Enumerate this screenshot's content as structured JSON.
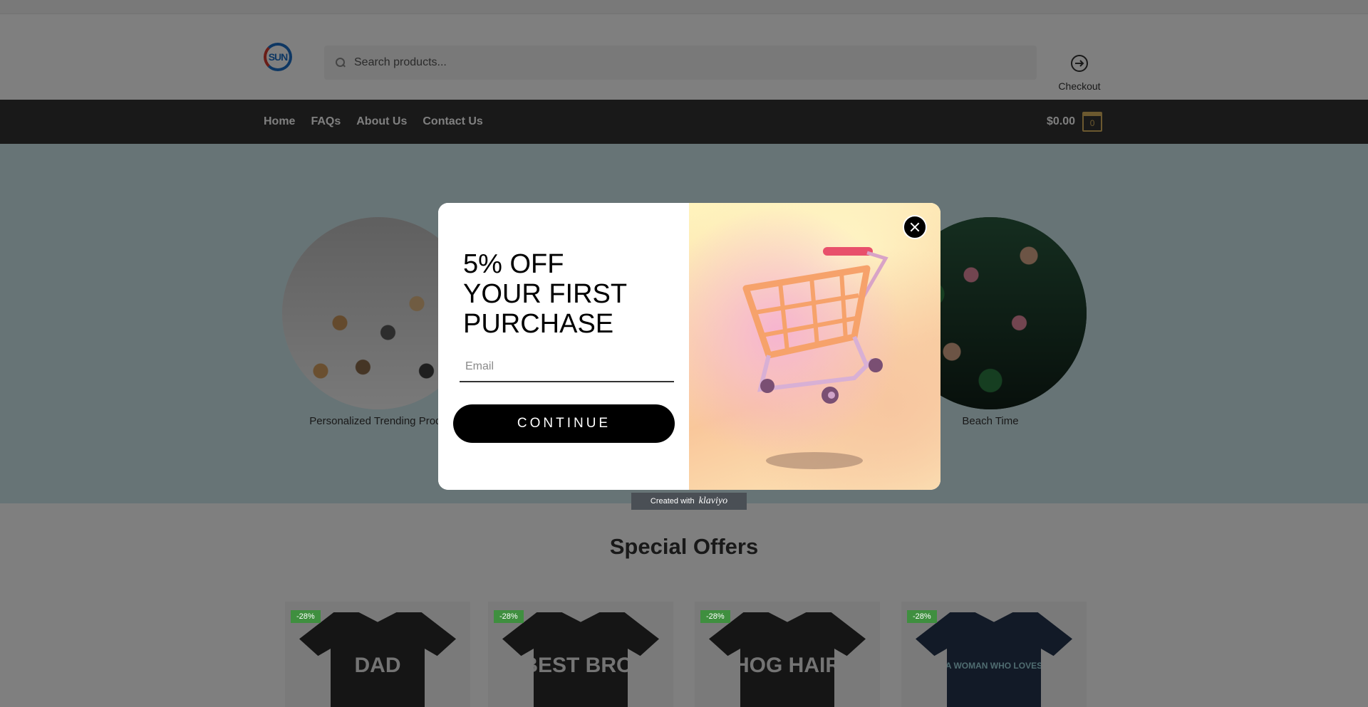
{
  "header": {
    "logo_text": "SUN",
    "search_placeholder": "Search products...",
    "checkout_label": "Checkout"
  },
  "nav": {
    "items": [
      {
        "label": "Home"
      },
      {
        "label": "FAQs"
      },
      {
        "label": "About Us"
      },
      {
        "label": "Contact Us"
      }
    ],
    "cart_total": "$0.00",
    "cart_count": "0"
  },
  "categories": [
    {
      "label": "Personalized Trending Produ"
    },
    {
      "label": "Beach Time"
    }
  ],
  "offers": {
    "title": "Special Offers",
    "products": [
      {
        "badge": "-28%",
        "print": "DAD"
      },
      {
        "badge": "-28%",
        "print": "BEST BRO."
      },
      {
        "badge": "-28%",
        "print": "HOG HAIR"
      },
      {
        "badge": "-28%",
        "print": "A WOMAN WHO LOVES"
      }
    ]
  },
  "popup": {
    "heading_lines": [
      "5% OFF",
      "YOUR FIRST",
      "PURCHASE"
    ],
    "email_placeholder": "Email",
    "continue_label": "CONTINUE",
    "footer_prefix": "Created with",
    "footer_brand": "klaviyo"
  },
  "colors": {
    "navbar": "#333333",
    "hero": "#cfe8ec",
    "badge": "#3f8f3f",
    "cart_accent": "#d8b25e",
    "overlay": "rgba(0,0,0,0.5)"
  },
  "icons": [
    "search-icon",
    "checkout-arrow-icon",
    "cart-icon",
    "close-icon",
    "shopping-cart-illustration"
  ]
}
